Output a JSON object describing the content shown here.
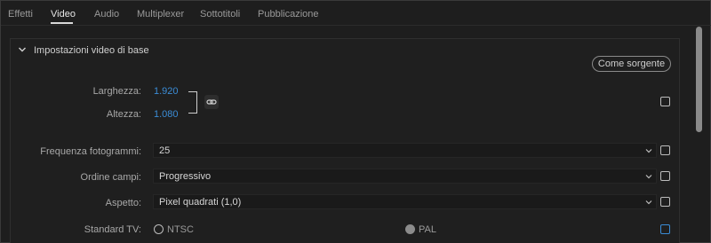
{
  "tabs": [
    {
      "label": "Effetti"
    },
    {
      "label": "Video"
    },
    {
      "label": "Audio"
    },
    {
      "label": "Multiplexer"
    },
    {
      "label": "Sottotitoli"
    },
    {
      "label": "Pubblicazione"
    }
  ],
  "active_tab": "Video",
  "section": {
    "title": "Impostazioni video di base",
    "match_source_label": "Come sorgente"
  },
  "fields": {
    "width": {
      "label": "Larghezza:",
      "value": "1.920"
    },
    "height": {
      "label": "Altezza:",
      "value": "1.080"
    },
    "frame_rate": {
      "label": "Frequenza fotogrammi:",
      "value": "25"
    },
    "field_order": {
      "label": "Ordine campi:",
      "value": "Progressivo"
    },
    "aspect": {
      "label": "Aspetto:",
      "value": "Pixel quadrati (1,0)"
    },
    "tv_standard": {
      "label": "Standard TV:",
      "options": [
        "NTSC",
        "PAL"
      ],
      "selected": "PAL"
    }
  },
  "icons": {
    "section_toggle": "chevron-down-icon",
    "link": "link-icon",
    "dropdown": "chevron-down-icon"
  },
  "colors": {
    "accent_blue": "#3b8cd6",
    "background": "#1e1e1e"
  }
}
